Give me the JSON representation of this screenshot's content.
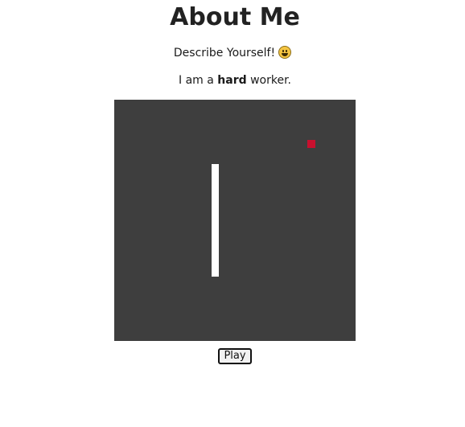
{
  "page": {
    "title": "About Me",
    "subtitle": "Describe Yourself!",
    "description_prefix": "I am a ",
    "description_bold": "hard",
    "description_suffix": " worker."
  },
  "game": {
    "background_color": "#3e3e3e",
    "paddle_color": "#ffffff",
    "ball_color": "#c8102e"
  },
  "controls": {
    "play_label": "Play"
  }
}
